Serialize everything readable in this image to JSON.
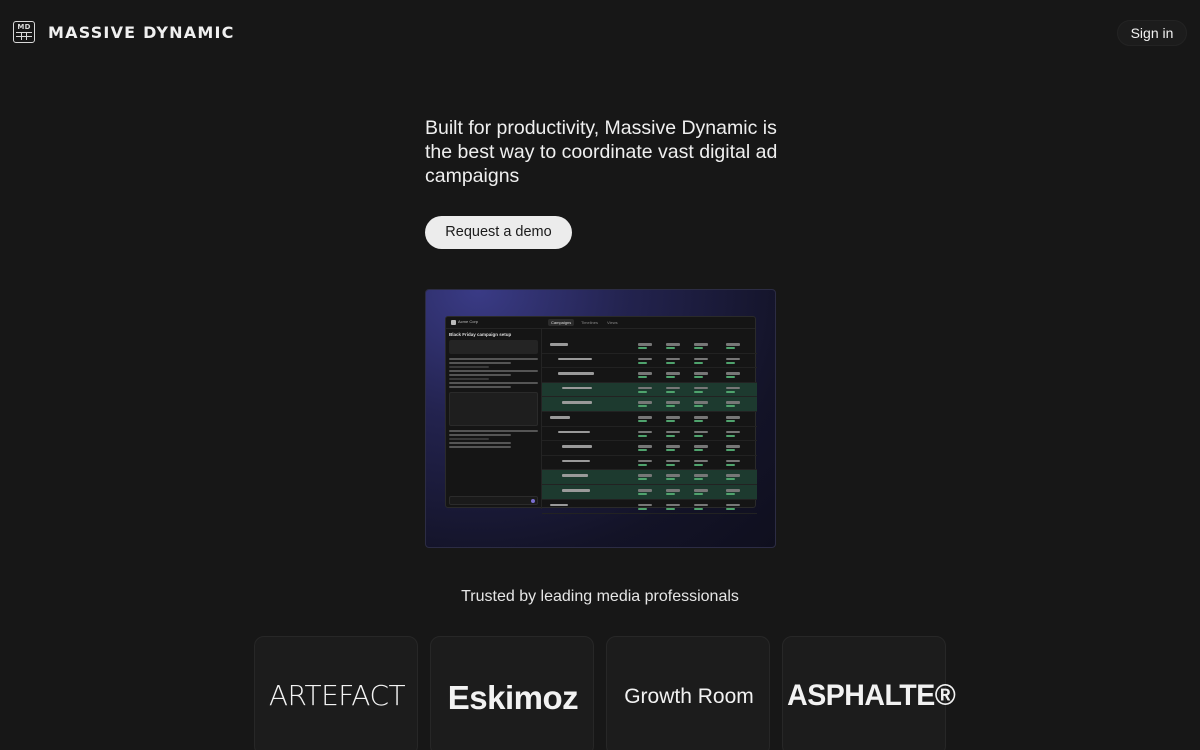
{
  "header": {
    "logo_icon": "md-grid-logo-icon",
    "logo_icon_text": "MD",
    "brand_name": "MASSIVE DYNAMIC",
    "sign_in_label": "Sign in"
  },
  "hero": {
    "headline": "Built for productivity, Massive Dynamic is the best way to coordinate vast digital ad campaigns",
    "cta_label": "Request a demo"
  },
  "preview": {
    "workspace_name": "Acme Corp",
    "tabs": [
      "Campaigns",
      "Timelines",
      "Views"
    ],
    "chat_title": "Black Friday campaign setup",
    "rows_highlighted": [
      false,
      false,
      false,
      true,
      true,
      false,
      false,
      false,
      false,
      true,
      true,
      false
    ]
  },
  "trusted": {
    "heading": "Trusted by leading media professionals",
    "logos": [
      "ARTEFACT",
      "Eskimoz",
      "Growth Room",
      "ASPHALTE®"
    ]
  },
  "colors": {
    "background": "#171717",
    "cta_background": "#ececec",
    "highlight_row": "#1d3a2f"
  }
}
